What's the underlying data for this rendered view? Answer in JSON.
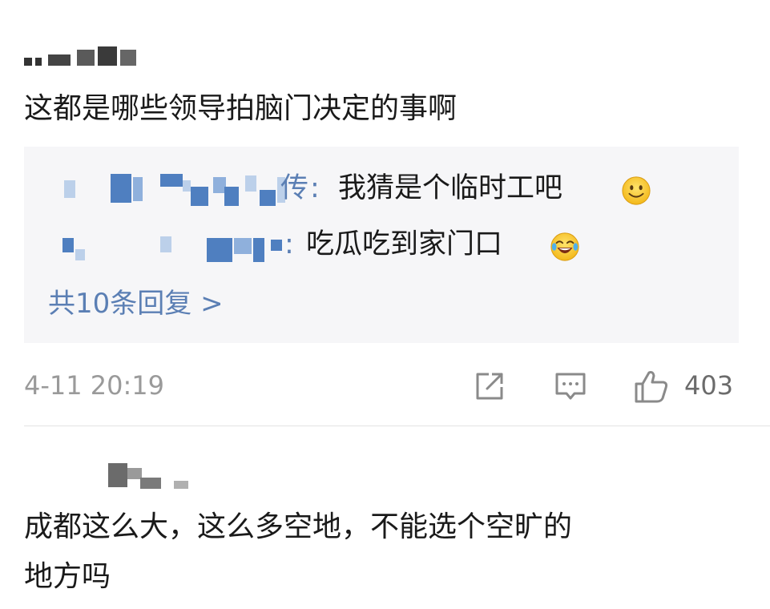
{
  "comments": [
    {
      "text": "这都是哪些领导拍脑门决定的事啊",
      "replies": [
        {
          "name_suffix": "传",
          "separator": ":",
          "text": "我猜是个临时工吧",
          "emoji": "smile-emoji"
        },
        {
          "name_suffix": "",
          "separator": ":",
          "text": "吃瓜吃到家门口",
          "emoji": "laugh-cry-emoji"
        }
      ],
      "more_replies_label": "共10条回复 >",
      "timestamp": "4-11 20:19",
      "like_count": "403",
      "icons": {
        "share": "share-icon",
        "comment": "comment-icon",
        "like": "thumbs-up-icon"
      }
    },
    {
      "text_line1": "成都这么大，这么多空地，不能选个空旷的",
      "text_line2": "地方吗"
    }
  ],
  "colors": {
    "link_blue": "#5b7fb4",
    "reply_bg": "#f6f6f8",
    "muted_gray": "#9a9a9a",
    "text": "#1a1a1a"
  }
}
